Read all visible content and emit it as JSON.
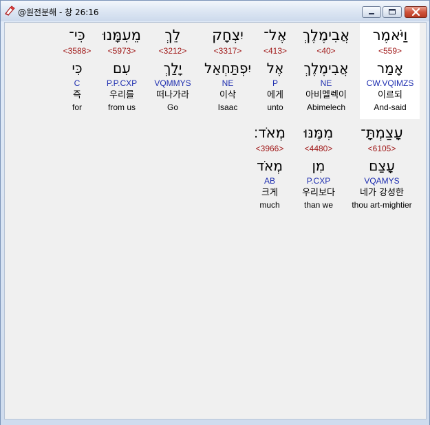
{
  "window": {
    "title": "@원전분해 - 창 26:16"
  },
  "rows": [
    {
      "words": [
        {
          "hebrew": "וַיֹּאמֶר",
          "strong": "<559>",
          "lemma": "אָמַר",
          "parse": "CW.VQIMZS",
          "korean": "이르되",
          "english": "And-said"
        },
        {
          "hebrew": "אֲבִימֶלֶךְ",
          "strong": "<40>",
          "lemma": "אֲבִימֶלֶךְ",
          "parse": "NE",
          "korean": "아비멜렉이",
          "english": "Abimelech"
        },
        {
          "hebrew": "אֶל־",
          "strong": "<413>",
          "lemma": "אֶל",
          "parse": "P",
          "korean": "에게",
          "english": "unto"
        },
        {
          "hebrew": "יִצְחָק",
          "strong": "<3317>",
          "lemma": "יִפְתַּחְאֵל",
          "parse": "NE",
          "korean": "이삭",
          "english": "Isaac"
        },
        {
          "hebrew": "לֵךְ",
          "strong": "<3212>",
          "lemma": "יָלַךְ",
          "parse": "VQMMYS",
          "korean": "떠나가라",
          "english": "Go"
        },
        {
          "hebrew": "מֵעִמָּנוּ",
          "strong": "<5973>",
          "lemma": "עִם",
          "parse": "P.P.CXP",
          "korean": "우리를",
          "english": "from us"
        },
        {
          "hebrew": "כִּי־",
          "strong": "<3588>",
          "lemma": "כִּי",
          "parse": "C",
          "korean": "즉",
          "english": "for"
        }
      ]
    },
    {
      "words": [
        {
          "hebrew": "עָצַמְתָּ־",
          "strong": "<6105>",
          "lemma": "עָצַם",
          "parse": "VQAMYS",
          "korean": "네가 강성한",
          "english": "thou art-mightier"
        },
        {
          "hebrew": "מִמֶּנּוּ",
          "strong": "<4480>",
          "lemma": "מִן",
          "parse": "P.CXP",
          "korean": "우리보다",
          "english": "than we"
        },
        {
          "hebrew": "מְאֹד׃",
          "strong": "<3966>",
          "lemma": "מְאֹד",
          "parse": "AB",
          "korean": "크게",
          "english": "much"
        }
      ]
    }
  ]
}
